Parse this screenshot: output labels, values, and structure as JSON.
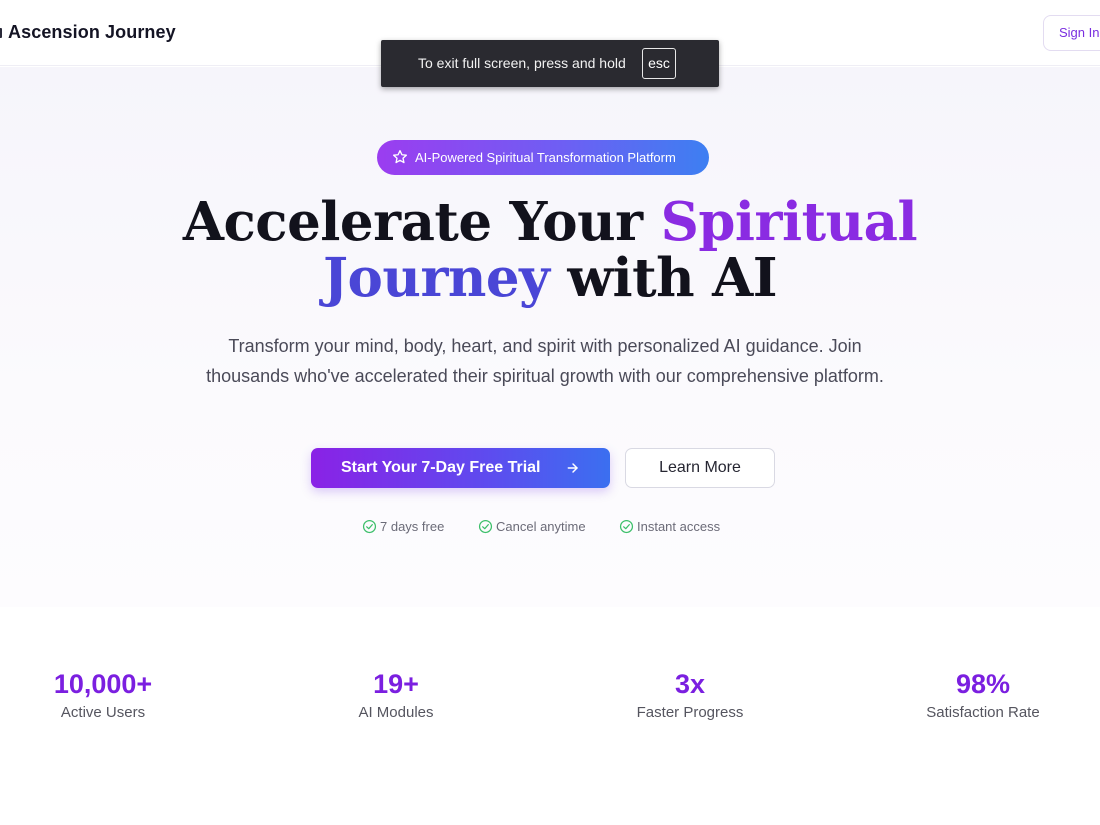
{
  "header": {
    "brand": "Ascension Journey",
    "sign_in_label": "Sign In"
  },
  "fullscreen_notice": {
    "text": "To exit full screen, press and hold",
    "key": "esc"
  },
  "hero": {
    "badge": {
      "icon": "star-icon",
      "text": "AI-Powered Spiritual Transformation Platform"
    },
    "headline": {
      "part1": "Accelerate Your ",
      "highlight1": "Spiritual",
      "highlight2": "Journey",
      "part2": " with AI"
    },
    "subtitle": "Transform your mind, body, heart, and spirit with personalized AI guidance. Join thousands who've accelerated their spiritual growth with our comprehensive platform.",
    "primary_cta": "Start Your 7-Day Free Trial",
    "secondary_cta": "Learn More",
    "features": [
      {
        "icon": "check-circle-icon",
        "label": "7 days free"
      },
      {
        "icon": "check-circle-icon",
        "label": "Cancel anytime"
      },
      {
        "icon": "check-circle-icon",
        "label": "Instant access"
      }
    ]
  },
  "stats": [
    {
      "value": "10,000+",
      "label": "Active Users"
    },
    {
      "value": "19+",
      "label": "AI Modules"
    },
    {
      "value": "3x",
      "label": "Faster Progress"
    },
    {
      "value": "98%",
      "label": "Satisfaction Rate"
    }
  ],
  "colors": {
    "brand_purple": "#8a2be2",
    "brand_blue": "#3b6ff0",
    "stat_purple": "#7b1fe0",
    "check_green": "#3cbf6a"
  }
}
